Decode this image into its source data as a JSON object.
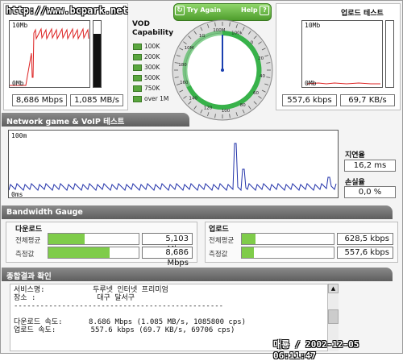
{
  "watermark": "http://www.bcpark.net",
  "download": {
    "rate": "8,686 Mbps",
    "bytes": "1,085 MB/s",
    "ymax": "10Mb",
    "ymin": "0Mb"
  },
  "upload": {
    "title": "업로드 테스트",
    "rate": "557,6 kbps",
    "bytes": "69,7 KB/s",
    "ymax": "10Mb",
    "ymin": "0Mb"
  },
  "vod": {
    "title": "VOD\nCapability",
    "items": [
      "100K",
      "200K",
      "300K",
      "500K",
      "750K",
      "over 1M"
    ]
  },
  "gauge": {
    "try_again": "Try Again",
    "help": "Help",
    "help_icon": "?",
    "scale": [
      "100k",
      "0",
      "20",
      "40",
      "60",
      "80",
      "100",
      "120",
      "140",
      "160",
      "180",
      "10M",
      "1G",
      "100M"
    ]
  },
  "network": {
    "title": "Network game & VoIP 테스트",
    "ymax": "100m",
    "ymin": "0ms",
    "latency_label": "지연율",
    "latency": "16,2 ms",
    "loss_label": "손실율",
    "loss": "0,0 %"
  },
  "bandwidth": {
    "title": "Bandwidth Gauge",
    "download": {
      "title": "다운로드",
      "avg_label": "전체평균",
      "avg_value": "5,103 Mbps",
      "avg_fraction": 0.4,
      "meas_label": "측정값",
      "meas_value": "8,686 Mbps",
      "meas_fraction": 0.68
    },
    "upload": {
      "title": "업로드",
      "avg_label": "전체평균",
      "avg_value": "628,5 kbps",
      "avg_fraction": 0.15,
      "meas_label": "측정값",
      "meas_value": "557,6 kbps",
      "meas_fraction": 0.13
    }
  },
  "summary": {
    "title": "종합결과 확인",
    "lines": [
      "서비스명:           두루넷 인터넷 프리미엄",
      "장소 :              대구 달서구",
      "------------------------------------------------",
      "",
      "다운로드 속도:      8.686 Mbps (1.085 MB/s, 1085800 cps)",
      "업로드 속도:        557.6 kbps (69.7 KB/s, 69706 cps)"
    ]
  },
  "stamp": "매룡 / 2002-12-05 06:11:47"
}
